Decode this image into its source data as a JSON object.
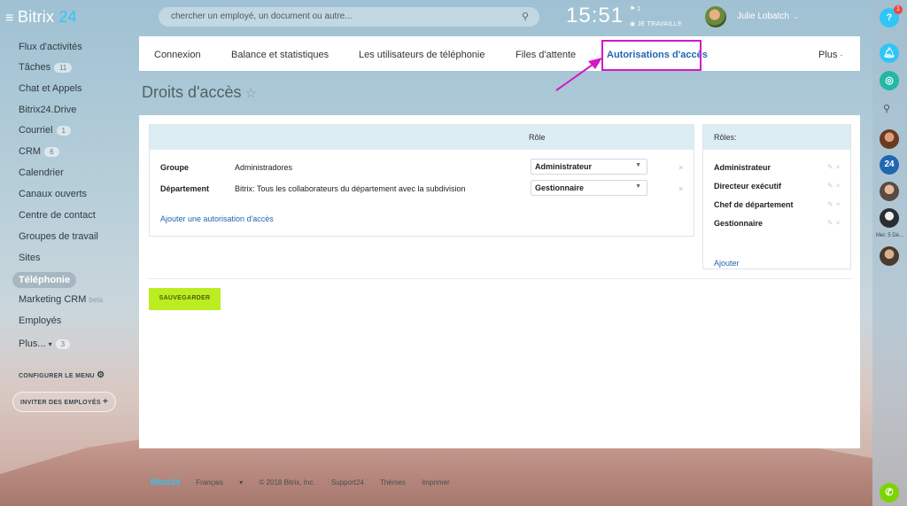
{
  "topbar": {
    "logo_text": "Bitrix",
    "logo_num": "24",
    "search_placeholder": "chercher un employé, un document ou autre...",
    "clock": "15:51",
    "clock_flag": "1",
    "work_status": "JE TRAVAILLE",
    "user_name": "Julie Lobatch"
  },
  "sidebar": {
    "items": [
      {
        "label": "Flux d'activités"
      },
      {
        "label": "Tâches",
        "badge": "11"
      },
      {
        "label": "Chat et Appels"
      },
      {
        "label": "Bitrix24.Drive"
      },
      {
        "label": "Courriel",
        "badge": "1"
      },
      {
        "label": "CRM",
        "badge": "6"
      },
      {
        "label": "Calendrier"
      },
      {
        "label": "Canaux ouverts"
      },
      {
        "label": "Centre de contact"
      },
      {
        "label": "Groupes de travail"
      },
      {
        "label": "Sites"
      },
      {
        "label": "Téléphonie"
      },
      {
        "label": "Marketing CRM",
        "tag": "beta"
      },
      {
        "label": "Employés"
      },
      {
        "label": "Plus...",
        "badge": "3"
      }
    ],
    "configure": "CONFIGURER LE MENU",
    "invite": "INVITER DES EMPLOYÉS"
  },
  "tabs": {
    "items": [
      "Connexion",
      "Balance et statistiques",
      "Les utilisateurs de téléphonie",
      "Files d'attente",
      "Autorisations d'accès"
    ],
    "active": "Autorisations d'accès",
    "more": "Plus"
  },
  "page": {
    "title": "Droits d'accès"
  },
  "permissions": {
    "role_header": "Rôle",
    "rows": [
      {
        "type": "Groupe",
        "value": "Administradores",
        "role": "Administrateur"
      },
      {
        "type": "Département",
        "value": "Bitrix: Tous les collaborateurs du département avec la subdivision",
        "role": "Gestionnaire"
      }
    ],
    "add_link": "Ajouter une autorisation d'accès"
  },
  "roles": {
    "header": "Rôles:",
    "items": [
      "Administrateur",
      "Directeur exécutif",
      "Chef de département",
      "Gestionnaire"
    ],
    "add": "Ajouter"
  },
  "save_button": "SAUVEGARDER",
  "footer": {
    "logo": "Bitrix24",
    "language": "Français",
    "copyright": "© 2018 Bitrix, Inc.",
    "support": "Support24",
    "themes": "Thèmes",
    "print": "Imprimer"
  },
  "right_panel": {
    "help": "?",
    "notif_count": "1",
    "date": "Mer. 5 Dé..."
  },
  "colors": {
    "accent_blue": "#2067b0",
    "save_green": "#bbed21",
    "highlight_magenta": "#d417c8",
    "header_blue": "#ddedf4"
  }
}
